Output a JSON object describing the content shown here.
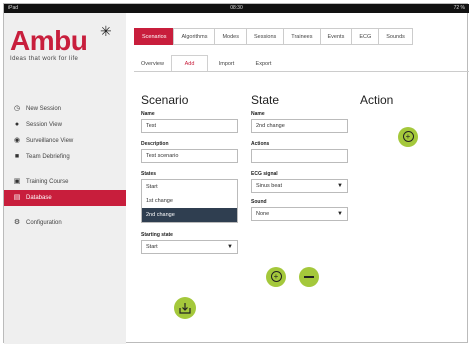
{
  "status_bar": {
    "left": "iPad",
    "center": "08:30",
    "right": "72 %"
  },
  "brand": {
    "logo_text": "Ambu",
    "tagline": "Ideas that work for life"
  },
  "sidebar": {
    "items": [
      {
        "label": "New Session",
        "icon": "clock-icon"
      },
      {
        "label": "Session View",
        "icon": "person-icon"
      },
      {
        "label": "Surveillance View",
        "icon": "eye-icon"
      },
      {
        "label": "Team Debriefing",
        "icon": "document-icon"
      },
      {
        "label": "Training Course",
        "icon": "course-icon"
      },
      {
        "label": "Database",
        "icon": "database-icon",
        "active": true
      },
      {
        "label": "Configuration",
        "icon": "gear-icon"
      }
    ]
  },
  "tabs": [
    "Scenarios",
    "Algorithms",
    "Modes",
    "Sessions",
    "Trainees",
    "Events",
    "ECG",
    "Sounds"
  ],
  "subtabs": [
    "Overview",
    "Add",
    "Import",
    "Export"
  ],
  "scenario": {
    "heading": "Scenario",
    "name_label": "Name",
    "name_value": "Test",
    "description_label": "Description",
    "description_value": "Test scenario",
    "states_label": "States",
    "states": [
      "Start",
      "1st change",
      "2nd change"
    ],
    "selected_state": "2nd change",
    "starting_state_label": "Starting state",
    "starting_state_value": "Start"
  },
  "state": {
    "heading": "State",
    "name_label": "Name",
    "name_value": "2nd change",
    "actions_label": "Actions",
    "actions_value": "",
    "ecg_label": "ECG signal",
    "ecg_value": "Sinus beat",
    "sound_label": "Sound",
    "sound_value": "None"
  },
  "action": {
    "heading": "Action"
  },
  "colors": {
    "accent": "#c81e3c",
    "button_green": "#a4c83b",
    "list_selected": "#2f3e50"
  }
}
